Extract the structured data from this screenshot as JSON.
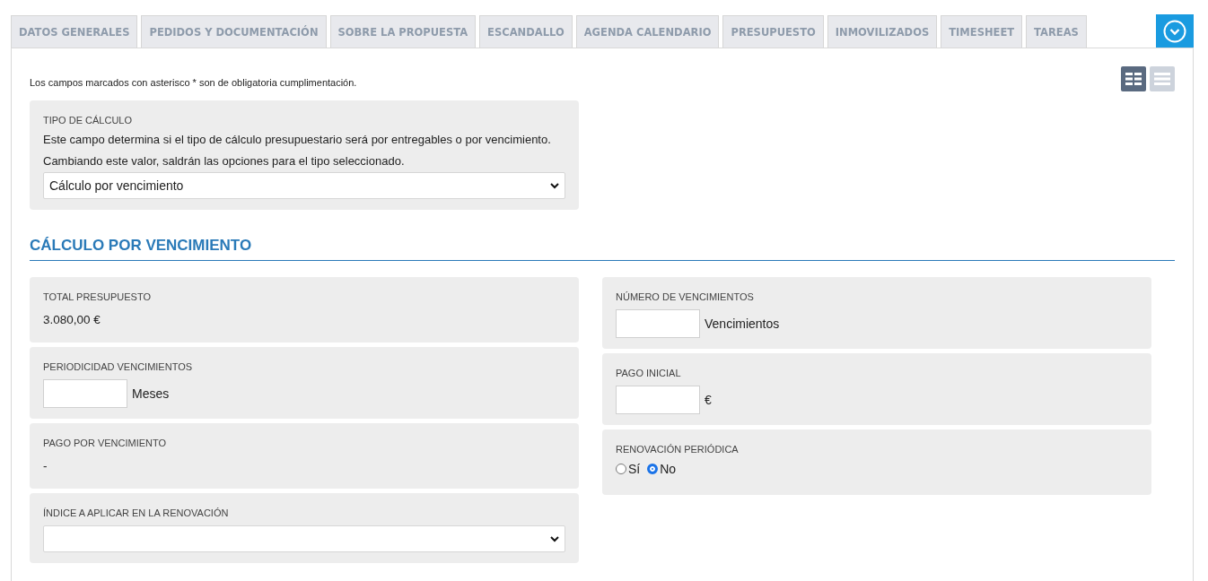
{
  "tabs": [
    {
      "label": "DATOS GENERALES",
      "selected": false
    },
    {
      "label": "PEDIDOS Y DOCUMENTACIÓN",
      "selected": false
    },
    {
      "label": "SOBRE LA PROPUESTA",
      "selected": false
    },
    {
      "label": "ESCANDALLO",
      "selected": false
    },
    {
      "label": "AGENDA CALENDARIO",
      "selected": false
    },
    {
      "label": "PRESUPUESTO",
      "selected": false
    },
    {
      "label": "INMOVILIZADOS",
      "selected": false
    },
    {
      "label": "TIMESHEET",
      "selected": false
    },
    {
      "label": "TAREAS",
      "selected": false
    }
  ],
  "view_toggle": [
    {
      "kind": "grid",
      "selected": true
    },
    {
      "kind": "list",
      "selected": false
    }
  ],
  "notice": "Los campos marcados con asterisco * son de obligatoria cumplimentación.",
  "calc_type": {
    "label": "TIPO DE CÁLCULO",
    "description": "Este campo determina si el tipo de cálculo presupuestario será por entregables o por vencimiento. Cambiando este valor, saldrán las opciones para el tipo seleccionado.",
    "value": "Cálculo por vencimiento"
  },
  "section": {
    "title": "CÁLCULO POR VENCIMIENTO",
    "left": [
      {
        "kind": "value",
        "label": "TOTAL PRESUPUESTO",
        "value": "3.080,00 €"
      },
      {
        "kind": "input",
        "label": "PERIODICIDAD VENCIMIENTOS",
        "unit": "Meses"
      },
      {
        "kind": "value",
        "label": "PAGO POR VENCIMIENTO",
        "value": "-"
      },
      {
        "kind": "select",
        "label": "ÍNDICE A APLICAR EN LA RENOVACIÓN"
      }
    ],
    "right": [
      {
        "kind": "input",
        "label": "NÚMERO DE VENCIMIENTOS",
        "unit": "Vencimientos"
      },
      {
        "kind": "input",
        "label": "PAGO INICIAL",
        "unit": "€"
      },
      {
        "kind": "radio",
        "label": "RENOVACIÓN PERIÓDICA",
        "options": [
          {
            "label": "Sí",
            "selected": false
          },
          {
            "label": "No",
            "selected": true
          }
        ]
      }
    ]
  }
}
